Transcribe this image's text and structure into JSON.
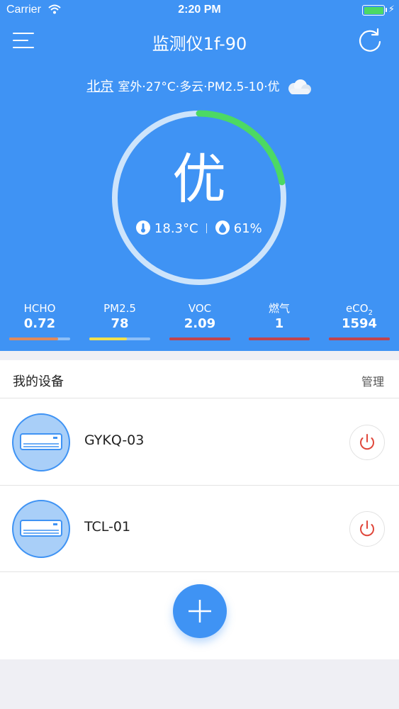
{
  "status_bar": {
    "carrier": "Carrier",
    "time": "2:20 PM"
  },
  "header": {
    "title": "监测仪1f-90"
  },
  "weather": {
    "city": "北京",
    "summary": "室外·27°C·多云·PM2.5-10·优"
  },
  "gauge": {
    "grade": "优",
    "progress": 0.22,
    "temperature": "18.3°C",
    "humidity": "61%"
  },
  "metrics": [
    {
      "label": "HCHO",
      "value": "0.72",
      "color": "#e08a5c",
      "level": 0.8
    },
    {
      "label": "PM2.5",
      "value": "78",
      "color": "#f2e04d",
      "level": 0.62
    },
    {
      "label": "VOC",
      "value": "2.09",
      "color": "#c0444e",
      "level": 1.0
    },
    {
      "label": "燃气",
      "value": "1",
      "color": "#c0444e",
      "level": 1.0
    },
    {
      "label": "eCO",
      "label_sub": "2",
      "value": "1594",
      "color": "#c0444e",
      "level": 1.0
    }
  ],
  "devices_section": {
    "title": "我的设备",
    "manage_label": "管理"
  },
  "devices": [
    {
      "name": "GYKQ-03"
    },
    {
      "name": "TCL-01"
    }
  ],
  "colors": {
    "primary": "#3f93f4",
    "gauge_active": "#4cd964",
    "power": "#e0473b"
  }
}
